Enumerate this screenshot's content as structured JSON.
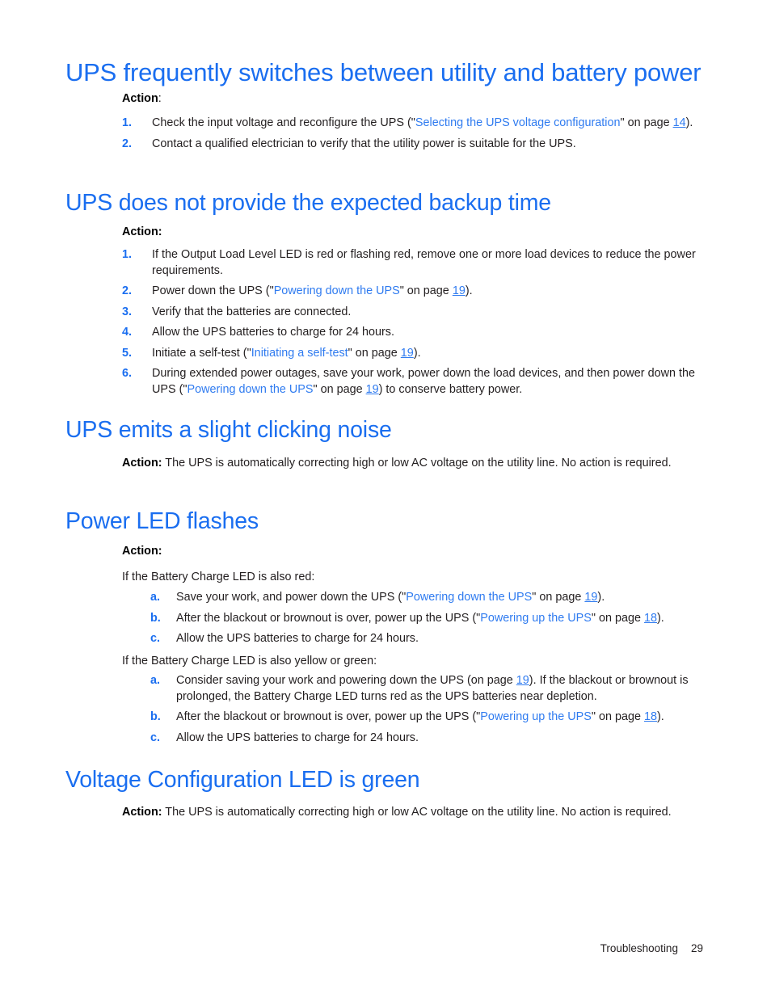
{
  "theme": {
    "heading_color": "#1a6ef0",
    "link_color": "#2f7bf0",
    "text_color": "#231f20",
    "page_background": "#ffffff"
  },
  "sections": [
    {
      "id": "ups-frequently-switches",
      "level": 1,
      "title": "UPS frequently switches between utility and battery power",
      "action_label": "Action",
      "action_colon": ":",
      "items": [
        {
          "marker": "1.",
          "parts": [
            {
              "t": "Check the input voltage and reconfigure the UPS (\"",
              "k": "plain"
            },
            {
              "t": "Selecting the UPS voltage configuration",
              "k": "link"
            },
            {
              "t": "\" on page ",
              "k": "plain"
            },
            {
              "t": "14",
              "k": "page"
            },
            {
              "t": ").",
              "k": "plain"
            }
          ]
        },
        {
          "marker": "2.",
          "parts": [
            {
              "t": "Contact a qualified electrician to verify that the utility power is suitable for the UPS.",
              "k": "plain"
            }
          ]
        }
      ]
    },
    {
      "id": "ups-does-not-provide-backup-time",
      "level": 2,
      "title": "UPS does not provide the expected backup time",
      "action_label": "Action:",
      "action_colon": "",
      "items": [
        {
          "marker": "1.",
          "parts": [
            {
              "t": "If the Output Load Level LED is red or flashing red, remove one or more load devices to reduce the power requirements.",
              "k": "plain"
            }
          ]
        },
        {
          "marker": "2.",
          "parts": [
            {
              "t": "Power down the UPS (\"",
              "k": "plain"
            },
            {
              "t": "Powering down the UPS",
              "k": "link"
            },
            {
              "t": "\" on page ",
              "k": "plain"
            },
            {
              "t": "19",
              "k": "page"
            },
            {
              "t": ").",
              "k": "plain"
            }
          ]
        },
        {
          "marker": "3.",
          "parts": [
            {
              "t": "Verify that the batteries are connected.",
              "k": "plain"
            }
          ]
        },
        {
          "marker": "4.",
          "parts": [
            {
              "t": "Allow the UPS batteries to charge for 24 hours.",
              "k": "plain"
            }
          ]
        },
        {
          "marker": "5.",
          "parts": [
            {
              "t": "Initiate a self-test (\"",
              "k": "plain"
            },
            {
              "t": "Initiating a self-test",
              "k": "link"
            },
            {
              "t": "\" on page ",
              "k": "plain"
            },
            {
              "t": "19",
              "k": "page"
            },
            {
              "t": ").",
              "k": "plain"
            }
          ]
        },
        {
          "marker": "6.",
          "parts": [
            {
              "t": "During extended power outages, save your work, power down the load devices, and then power down the UPS (\"",
              "k": "plain"
            },
            {
              "t": "Powering down the UPS",
              "k": "link"
            },
            {
              "t": "\" on page ",
              "k": "plain"
            },
            {
              "t": "19",
              "k": "page"
            },
            {
              "t": ") to conserve battery power.",
              "k": "plain"
            }
          ]
        }
      ]
    },
    {
      "id": "ups-emits-clicking-noise",
      "level": 2,
      "title": "UPS emits a slight clicking noise",
      "action_label": "Action:",
      "action_text": " The UPS is automatically correcting high or low AC voltage on the utility line. No action is required."
    },
    {
      "id": "power-led-flashes",
      "level": 2,
      "title": "Power LED flashes",
      "action_label": "Action:",
      "groups": [
        {
          "lead": "If the Battery Charge LED is also red:",
          "items": [
            {
              "marker": "a.",
              "parts": [
                {
                  "t": "Save your work, and power down the UPS (\"",
                  "k": "plain"
                },
                {
                  "t": "Powering down the UPS",
                  "k": "link"
                },
                {
                  "t": "\" on page ",
                  "k": "plain"
                },
                {
                  "t": "19",
                  "k": "page"
                },
                {
                  "t": ").",
                  "k": "plain"
                }
              ]
            },
            {
              "marker": "b.",
              "parts": [
                {
                  "t": "After the blackout or brownout is over, power up the UPS (\"",
                  "k": "plain"
                },
                {
                  "t": "Powering up the UPS",
                  "k": "link"
                },
                {
                  "t": "\" on page ",
                  "k": "plain"
                },
                {
                  "t": "18",
                  "k": "page"
                },
                {
                  "t": ").",
                  "k": "plain"
                }
              ]
            },
            {
              "marker": "c.",
              "parts": [
                {
                  "t": "Allow the UPS batteries to charge for 24 hours.",
                  "k": "plain"
                }
              ]
            }
          ]
        },
        {
          "lead": "If the Battery Charge LED is also yellow or green:",
          "items": [
            {
              "marker": "a.",
              "parts": [
                {
                  "t": "Consider saving your work and powering down the UPS (on page ",
                  "k": "plain"
                },
                {
                  "t": "19",
                  "k": "page"
                },
                {
                  "t": "). If the blackout or brownout is prolonged, the Battery Charge LED turns red as the UPS batteries near depletion.",
                  "k": "plain"
                }
              ]
            },
            {
              "marker": "b.",
              "parts": [
                {
                  "t": "After the blackout or brownout is over, power up the UPS (\"",
                  "k": "plain"
                },
                {
                  "t": "Powering up the UPS",
                  "k": "link"
                },
                {
                  "t": "\" on page ",
                  "k": "plain"
                },
                {
                  "t": "18",
                  "k": "page"
                },
                {
                  "t": ").",
                  "k": "plain"
                }
              ]
            },
            {
              "marker": "c.",
              "parts": [
                {
                  "t": "Allow the UPS batteries to charge for 24 hours.",
                  "k": "plain"
                }
              ]
            }
          ]
        }
      ]
    },
    {
      "id": "voltage-configuration-led-green",
      "level": 2,
      "title": "Voltage Configuration LED is green",
      "action_label": "Action:",
      "action_text": " The UPS is automatically correcting high or low AC voltage on the utility line. No action is required."
    }
  ],
  "footer": {
    "chapter": "Troubleshooting",
    "page_number": "29"
  }
}
